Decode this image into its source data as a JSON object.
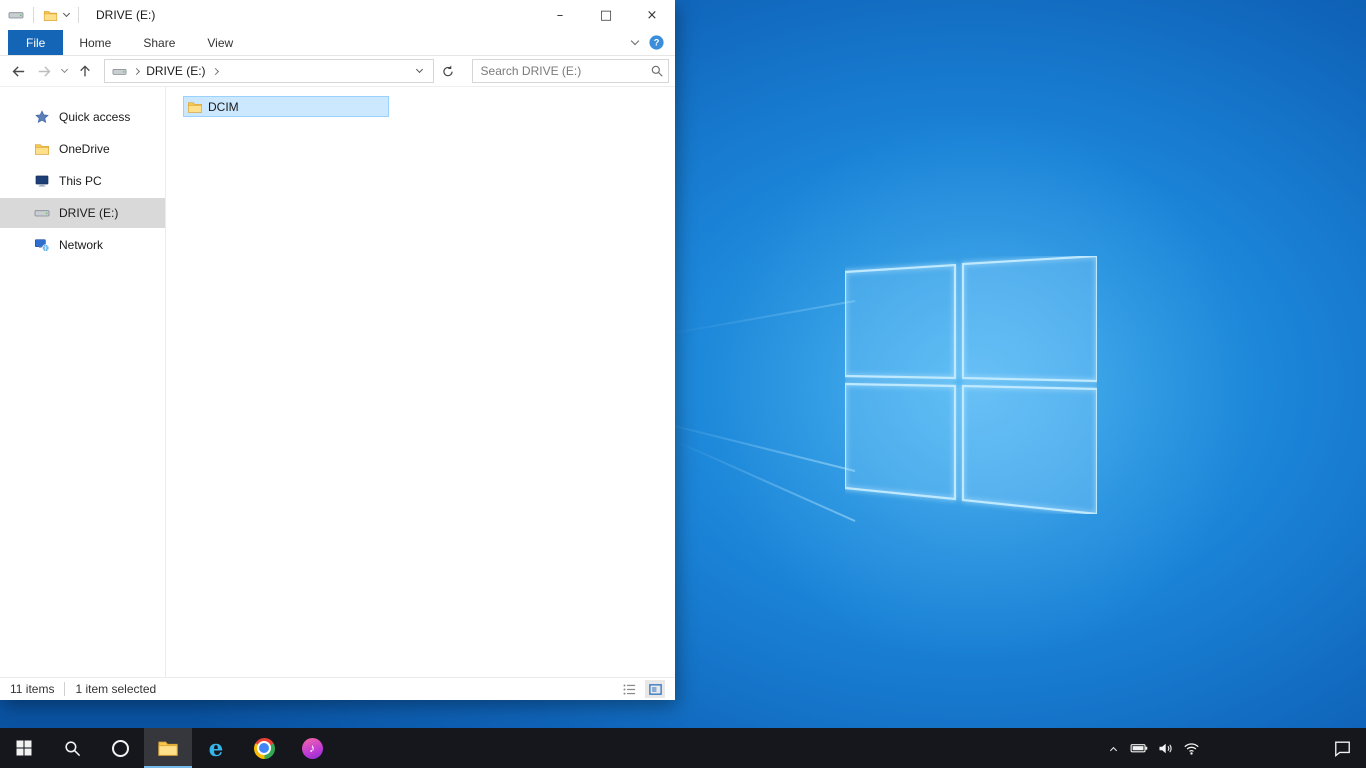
{
  "window": {
    "title": "DRIVE (E:)",
    "controls": {
      "minimize": "–",
      "maximize": "□",
      "close": "×"
    }
  },
  "ribbon": {
    "tabs": [
      "File",
      "Home",
      "Share",
      "View"
    ]
  },
  "navbar": {
    "breadcrumb_root": "DRIVE (E:)",
    "search_placeholder": "Search DRIVE (E:)"
  },
  "sidebar": {
    "items": [
      {
        "label": "Quick access",
        "icon": "star-icon",
        "selected": false
      },
      {
        "label": "OneDrive",
        "icon": "folder-icon",
        "selected": false
      },
      {
        "label": "This PC",
        "icon": "pc-icon",
        "selected": false
      },
      {
        "label": "DRIVE (E:)",
        "icon": "drive-icon",
        "selected": true
      },
      {
        "label": "Network",
        "icon": "network-icon",
        "selected": false
      }
    ]
  },
  "content": {
    "items": [
      {
        "label": "DCIM",
        "icon": "folder-icon",
        "selected": true
      }
    ]
  },
  "statusbar": {
    "count": "11 items",
    "selected": "1 item selected"
  },
  "taskbar": {
    "apps": [
      "start",
      "search",
      "cortana",
      "file-explorer",
      "internet-explorer",
      "chrome",
      "itunes"
    ],
    "active_app": "file-explorer",
    "tray": [
      "hidden-icons",
      "battery",
      "volume",
      "wifi",
      "action-center"
    ]
  },
  "icons": {
    "ie_glyph": "e",
    "itunes_glyph": "♪"
  },
  "colors": {
    "accent": "#0078d7",
    "file_tab_blue": "#1565b6",
    "selection_bg": "#cce8ff",
    "selection_border": "#99d1ff",
    "sidebar_selected": "#d9d9d9",
    "taskbar_bg": "#15171c"
  }
}
